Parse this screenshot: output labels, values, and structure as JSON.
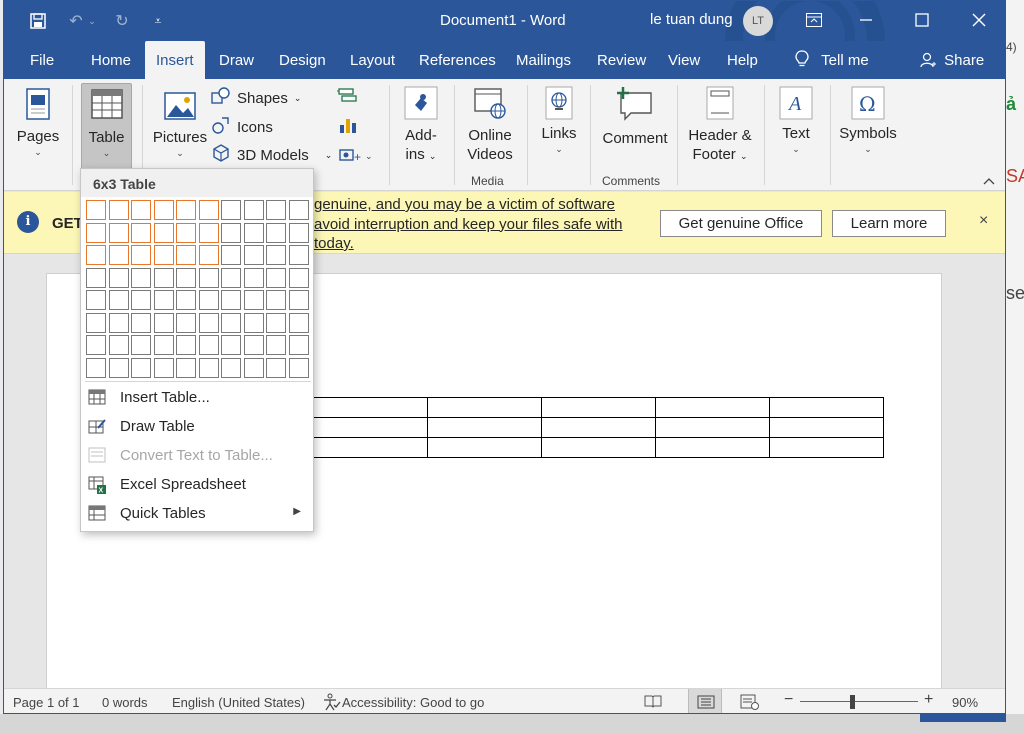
{
  "titlebar": {
    "document_title": "Document1 - Word",
    "user_name": "le tuan dung",
    "avatar_initials": "LT"
  },
  "tabs": [
    "File",
    "Home",
    "Insert",
    "Draw",
    "Design",
    "Layout",
    "References",
    "Mailings",
    "Review",
    "View",
    "Help"
  ],
  "active_tab": "Insert",
  "tell_me": "Tell me",
  "share": "Share",
  "ribbon": {
    "pages": "Pages",
    "table": "Table",
    "pictures": "Pictures",
    "shapes": "Shapes",
    "icons": "Icons",
    "models_3d": "3D Models",
    "addins_line1": "Add-",
    "addins_line2": "ins",
    "online_videos_line1": "Online",
    "online_videos_line2": "Videos",
    "media_group": "Media",
    "links": "Links",
    "comment": "Comment",
    "comments_group": "Comments",
    "header_footer_line1": "Header &",
    "header_footer_line2": "Footer",
    "text": "Text",
    "symbols": "Symbols"
  },
  "infobar": {
    "get_label": "GET",
    "message": "genuine, and you may be a victim of software avoid interruption and keep your files safe with today.",
    "get_genuine": "Get genuine Office",
    "learn_more": "Learn more",
    "close": "×"
  },
  "table_dropdown": {
    "header": "6x3 Table",
    "grid_cols": 10,
    "grid_rows": 8,
    "selected_cols": 6,
    "selected_rows": 3,
    "items": [
      {
        "label": "Insert Table...",
        "disabled": false,
        "submenu": false
      },
      {
        "label": "Draw Table",
        "disabled": false,
        "submenu": false
      },
      {
        "label": "Convert Text to Table...",
        "disabled": true,
        "submenu": false
      },
      {
        "label": "Excel Spreadsheet",
        "disabled": false,
        "submenu": false
      },
      {
        "label": "Quick Tables",
        "disabled": false,
        "submenu": true
      }
    ]
  },
  "document_table": {
    "rows": 3,
    "cols": 6
  },
  "statusbar": {
    "page": "Page 1 of 1",
    "words": "0 words",
    "language": "English (United States)",
    "accessibility": "Accessibility: Good to go",
    "zoom": "90%"
  },
  "colors": {
    "word_blue": "#2b579a",
    "grid_highlight": "#e8762b",
    "infobar_bg": "#fcf7b6"
  }
}
